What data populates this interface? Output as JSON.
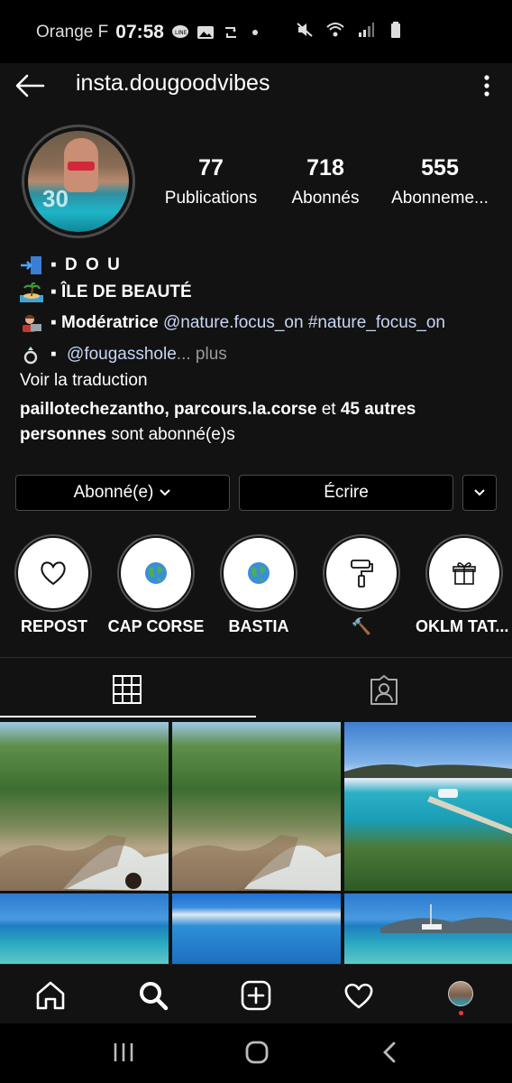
{
  "status_bar": {
    "carrier": "Orange F",
    "time": "07:58"
  },
  "header": {
    "username": "insta.dougoodvibes"
  },
  "stats": [
    {
      "count": "77",
      "label": "Publications"
    },
    {
      "count": "718",
      "label": "Abonnés"
    },
    {
      "count": "555",
      "label": "Abonneme..."
    }
  ],
  "bio": {
    "line1": "▪ D O U",
    "line2": "▪ ÎLE DE BEAUTÉ",
    "line3_bold": "▪ Modératrice",
    "line3_mention": "@nature.focus_on",
    "line3_tag": "#nature_focus_on",
    "line4_prefix": "▪",
    "line4_mention": "@fougassholе",
    "line4_more": "... plus",
    "translate": "Voir la traduction",
    "followed_by_names": "paillotechezantho, parcours.la.corse",
    "followed_by_and": "et",
    "followed_by_count": "45 autres personnes",
    "followed_by_suffix": "sont abonné(e)s"
  },
  "buttons": {
    "following": "Abonné(e)",
    "message": "Écrire"
  },
  "highlights": [
    {
      "label": "REPOST",
      "icon": "heart-icon"
    },
    {
      "label": "CAP CORSE",
      "icon": "globe-icon"
    },
    {
      "label": "BASTIA",
      "icon": "globe-icon"
    },
    {
      "label": "🔨",
      "icon": "paint-roller-icon"
    },
    {
      "label": "OKLM TAT...",
      "icon": "gift-icon"
    }
  ],
  "tabs": {
    "active": "grid"
  },
  "colors": {
    "background": "#121212",
    "link": "#c8d6f5",
    "notification_dot": "#ff3040"
  }
}
